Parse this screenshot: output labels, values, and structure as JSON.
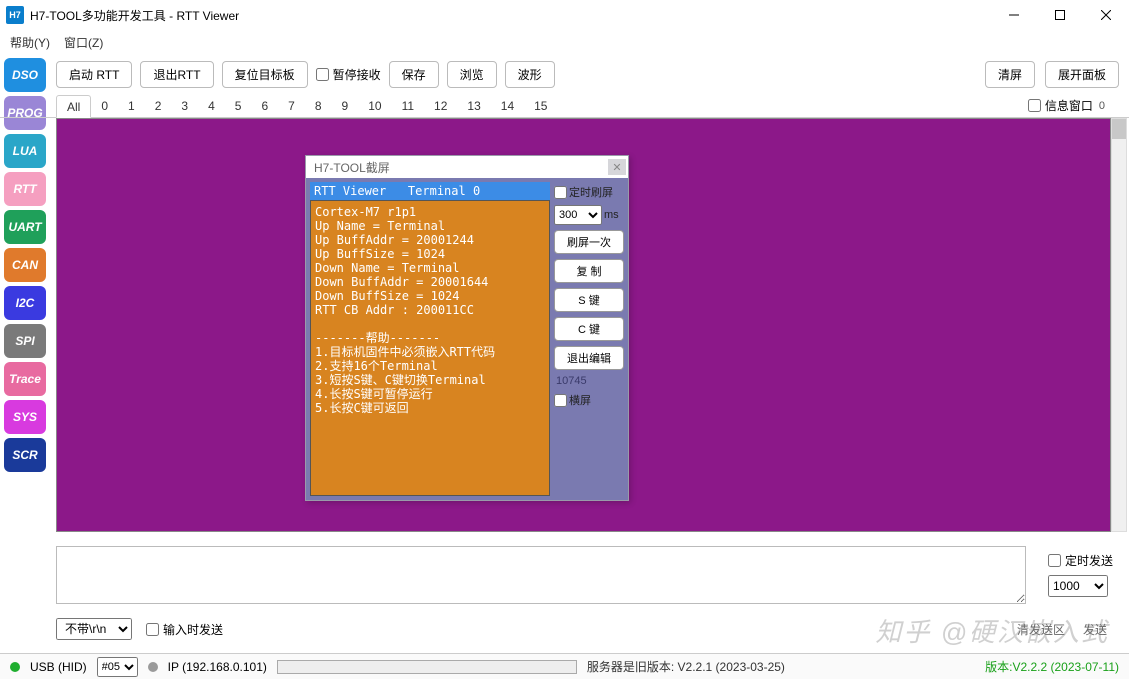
{
  "titlebar": {
    "icon_text": "H7",
    "title": "H7-TOOL多功能开发工具 - RTT Viewer"
  },
  "menu": {
    "help": "帮助(Y)",
    "window": "窗口(Z)"
  },
  "toolbar": {
    "start_rtt": "启动 RTT",
    "exit_rtt": "退出RTT",
    "reset_target": "复位目标板",
    "pause_recv": "暂停接收",
    "save": "保存",
    "browse": "浏览",
    "wave": "波形",
    "clear": "清屏",
    "expand_panel": "展开面板"
  },
  "tabs": {
    "all": "All",
    "numbers": [
      "0",
      "1",
      "2",
      "3",
      "4",
      "5",
      "6",
      "7",
      "8",
      "9",
      "10",
      "11",
      "12",
      "13",
      "14",
      "15"
    ],
    "info_window": "信息窗口",
    "count": "0"
  },
  "sidebar": [
    {
      "label": "DSO",
      "bg": "#1f8fe0"
    },
    {
      "label": "PROG",
      "bg": "#9a86d6"
    },
    {
      "label": "LUA",
      "bg": "#2aa6c8"
    },
    {
      "label": "RTT",
      "bg": "#f59fc0"
    },
    {
      "label": "UART",
      "bg": "#1fa05a"
    },
    {
      "label": "CAN",
      "bg": "#e07a2c"
    },
    {
      "label": "I2C",
      "bg": "#3a3ae0"
    },
    {
      "label": "SPI",
      "bg": "#7a7a7a"
    },
    {
      "label": "Trace",
      "bg": "#e86aa0"
    },
    {
      "label": "SYS",
      "bg": "#d83adf"
    },
    {
      "label": "SCR",
      "bg": "#1a3a9a"
    }
  ],
  "inner": {
    "title": "H7-TOOL截屏",
    "term_header": "RTT Viewer   Terminal 0",
    "term_body": "Cortex-M7 r1p1\nUp Name = Terminal\nUp BuffAddr = 20001244\nUp BuffSize = 1024\nDown Name = Terminal\nDown BuffAddr = 20001644\nDown BuffSize = 1024\nRTT CB Addr : 200011CC\n\n-------帮助-------\n1.目标机固件中必须嵌入RTT代码\n2.支持16个Terminal\n3.短按S键、C键切换Terminal\n4.长按S键可暂停运行\n5.长按C键可返回",
    "timed_refresh": "定时刷屏",
    "interval_value": "300",
    "interval_unit": "ms",
    "refresh_once": "刷屏一次",
    "copy": "复 制",
    "s_key": "S 键",
    "c_key": "C 键",
    "exit_edit": "退出编辑",
    "count": "10745",
    "landscape": "横屏"
  },
  "send": {
    "timed_send": "定时发送",
    "interval": "1000",
    "line_ending": "不带\\r\\n",
    "send_on_input": "输入时发送",
    "clear_send": "清发送区",
    "send_btn": "发送"
  },
  "status": {
    "usb": "USB (HID)",
    "channel": "#05",
    "ip": "IP (192.168.0.101)",
    "server": "服务器是旧版本: V2.2.1 (2023-03-25)",
    "version": "版本:V2.2.2 (2023-07-11)"
  },
  "watermark": "知乎 @硬汉嵌入式"
}
